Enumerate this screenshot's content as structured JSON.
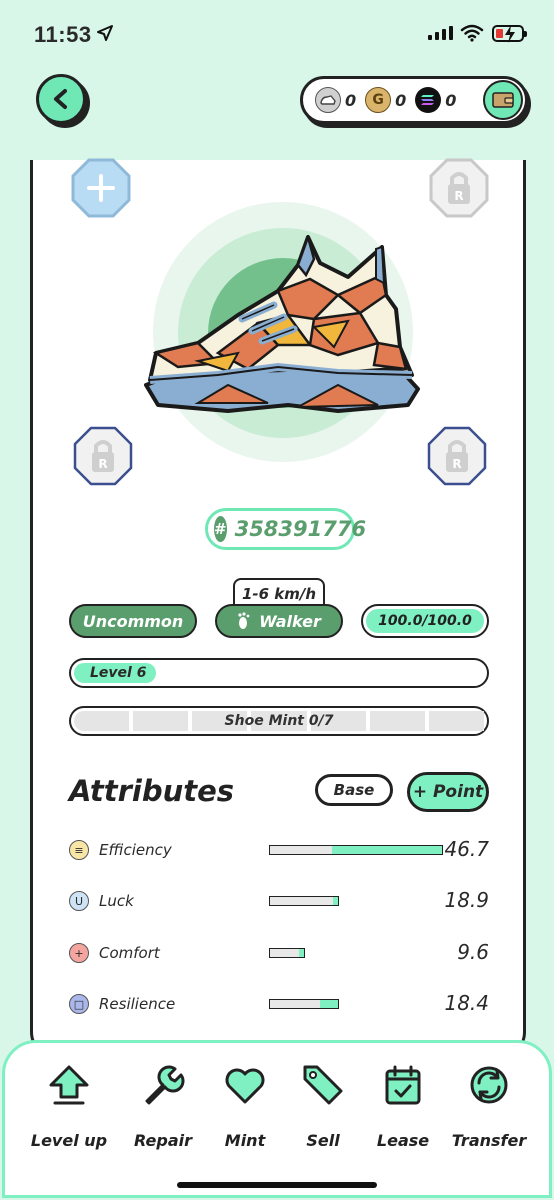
{
  "status_bar": {
    "time": "11:53"
  },
  "header": {
    "wallet": {
      "coins": [
        {
          "name": "gst-token",
          "value": "0",
          "color": "#9e9e9e"
        },
        {
          "name": "gmt-token",
          "value": "0",
          "color": "#d9b46a"
        },
        {
          "name": "sol-token",
          "value": "0",
          "color": "#111111"
        }
      ]
    }
  },
  "shoe": {
    "id_hash": "#",
    "id": "358391776",
    "speed_range": "1-6 km/h",
    "rarity": "Uncommon",
    "type": "Walker",
    "durability": "100.0/100.0",
    "durability_fraction": 1.0,
    "level": "Level 6",
    "mint": "Shoe Mint 0/7",
    "mint_segments": 7
  },
  "attributes": {
    "title": "Attributes",
    "base_button": "Base",
    "point_button": "+ Point",
    "items": [
      {
        "name": "Efficiency",
        "value": "46.7",
        "icon_color": "#f7e6a6",
        "icon_glyph": "≡"
      },
      {
        "name": "Luck",
        "value": "18.9",
        "icon_color": "#cfe3f7",
        "icon_glyph": "U"
      },
      {
        "name": "Comfort",
        "value": "9.6",
        "icon_color": "#f5a5a0",
        "icon_glyph": "+"
      },
      {
        "name": "Resilience",
        "value": "18.4",
        "icon_color": "#aab7ea",
        "icon_glyph": "□"
      }
    ]
  },
  "bottom_nav": {
    "items": [
      {
        "label": "Level up",
        "icon": "level-up-arrow-icon"
      },
      {
        "label": "Repair",
        "icon": "wrench-icon"
      },
      {
        "label": "Mint",
        "icon": "heart-icon"
      },
      {
        "label": "Sell",
        "icon": "tag-icon"
      },
      {
        "label": "Lease",
        "icon": "calendar-icon"
      },
      {
        "label": "Transfer",
        "icon": "transfer-icon"
      }
    ]
  },
  "colors": {
    "background": "#d9f7e8",
    "accent": "#7ef0c2",
    "dark_green": "#5b9e6e"
  }
}
